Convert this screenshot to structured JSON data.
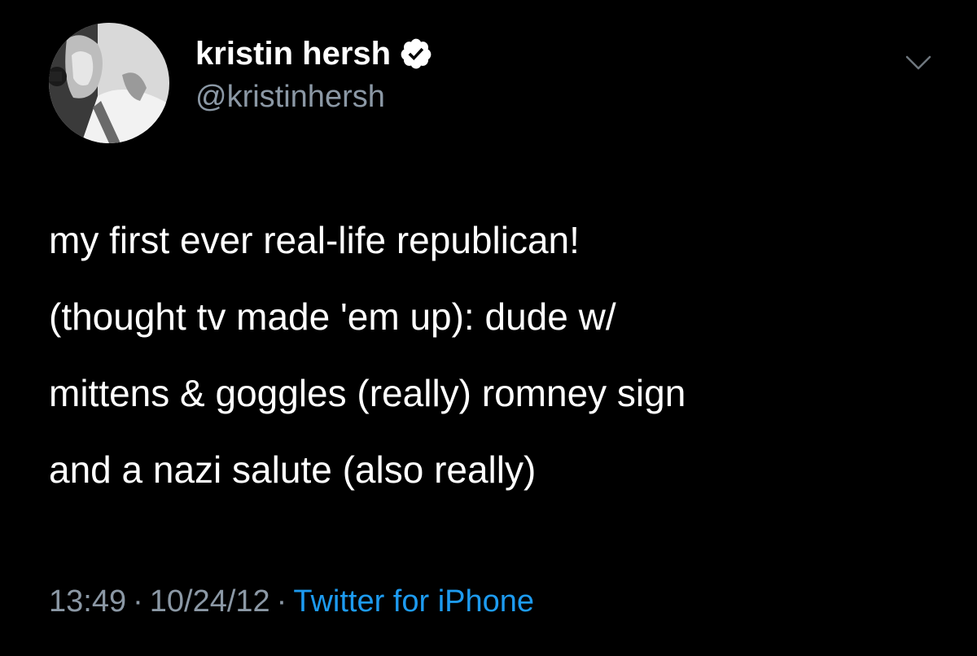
{
  "user": {
    "display_name": "kristin hersh",
    "handle": "@kristinhersh",
    "verified": true
  },
  "tweet": {
    "lines": [
      "my first ever real-life republican!",
      "(thought tv made 'em up): dude w/",
      "mittens & goggles (really) romney sign",
      "and a nazi salute (also really)"
    ]
  },
  "meta": {
    "time": "13:49",
    "separator": "·",
    "date": "10/24/12",
    "source": "Twitter for iPhone"
  },
  "icons": {
    "verified": "verified-badge-icon",
    "menu": "chevron-down-icon"
  },
  "colors": {
    "background": "#000000",
    "text": "#ffffff",
    "secondary": "#8b98a5",
    "link": "#1d9bf0"
  }
}
